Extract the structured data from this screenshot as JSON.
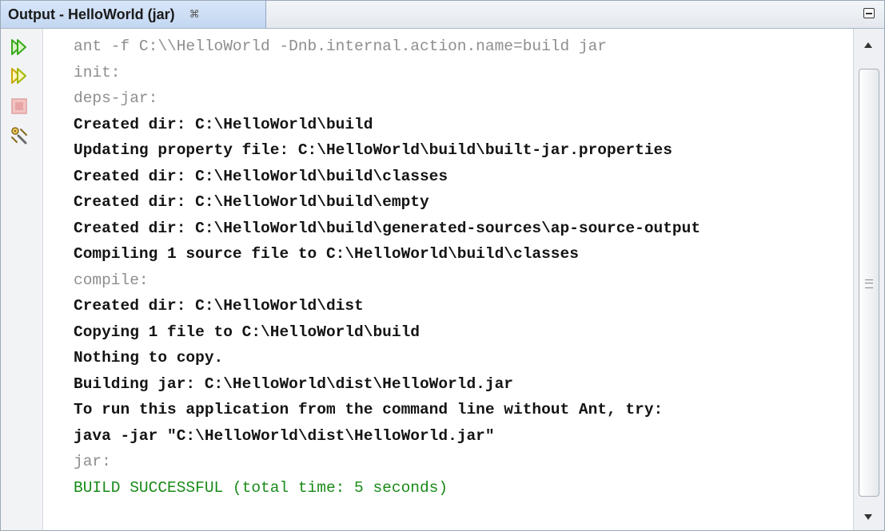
{
  "window": {
    "tab_title": "Output - HelloWorld (jar)",
    "tab_close_glyph": "⌘"
  },
  "toolbar": {
    "buttons": [
      {
        "name": "rerun",
        "icon": "double-play-icon",
        "color": "#3aa81c"
      },
      {
        "name": "rerun-with-params",
        "icon": "double-play-icon",
        "color": "#c9a800"
      },
      {
        "name": "stop",
        "icon": "stop-icon",
        "color": "#e8a4a4"
      },
      {
        "name": "settings",
        "icon": "wrench-gear-icon",
        "color": "#8a6a20"
      }
    ]
  },
  "output": {
    "lines": [
      {
        "text": "ant -f C:\\\\HelloWorld -Dnb.internal.action.name=build jar",
        "kind": "meta"
      },
      {
        "text": "init:",
        "kind": "meta"
      },
      {
        "text": "deps-jar:",
        "kind": "meta"
      },
      {
        "text": "Created dir: C:\\HelloWorld\\build",
        "kind": "normal"
      },
      {
        "text": "Updating property file: C:\\HelloWorld\\build\\built-jar.properties",
        "kind": "normal"
      },
      {
        "text": "Created dir: C:\\HelloWorld\\build\\classes",
        "kind": "normal"
      },
      {
        "text": "Created dir: C:\\HelloWorld\\build\\empty",
        "kind": "normal"
      },
      {
        "text": "Created dir: C:\\HelloWorld\\build\\generated-sources\\ap-source-output",
        "kind": "normal"
      },
      {
        "text": "Compiling 1 source file to C:\\HelloWorld\\build\\classes",
        "kind": "normal"
      },
      {
        "text": "compile:",
        "kind": "meta"
      },
      {
        "text": "Created dir: C:\\HelloWorld\\dist",
        "kind": "normal"
      },
      {
        "text": "Copying 1 file to C:\\HelloWorld\\build",
        "kind": "normal"
      },
      {
        "text": "Nothing to copy.",
        "kind": "normal"
      },
      {
        "text": "Building jar: C:\\HelloWorld\\dist\\HelloWorld.jar",
        "kind": "normal"
      },
      {
        "text": "To run this application from the command line without Ant, try:",
        "kind": "normal"
      },
      {
        "text": "java -jar \"C:\\HelloWorld\\dist\\HelloWorld.jar\"",
        "kind": "normal"
      },
      {
        "text": "jar:",
        "kind": "meta"
      },
      {
        "text": "BUILD SUCCESSFUL (total time: 5 seconds)",
        "kind": "success"
      }
    ]
  },
  "colors": {
    "meta_text": "#8e8e8e",
    "normal_text": "#141414",
    "success_text": "#198a19",
    "tab_active": "#c3d7f2"
  }
}
